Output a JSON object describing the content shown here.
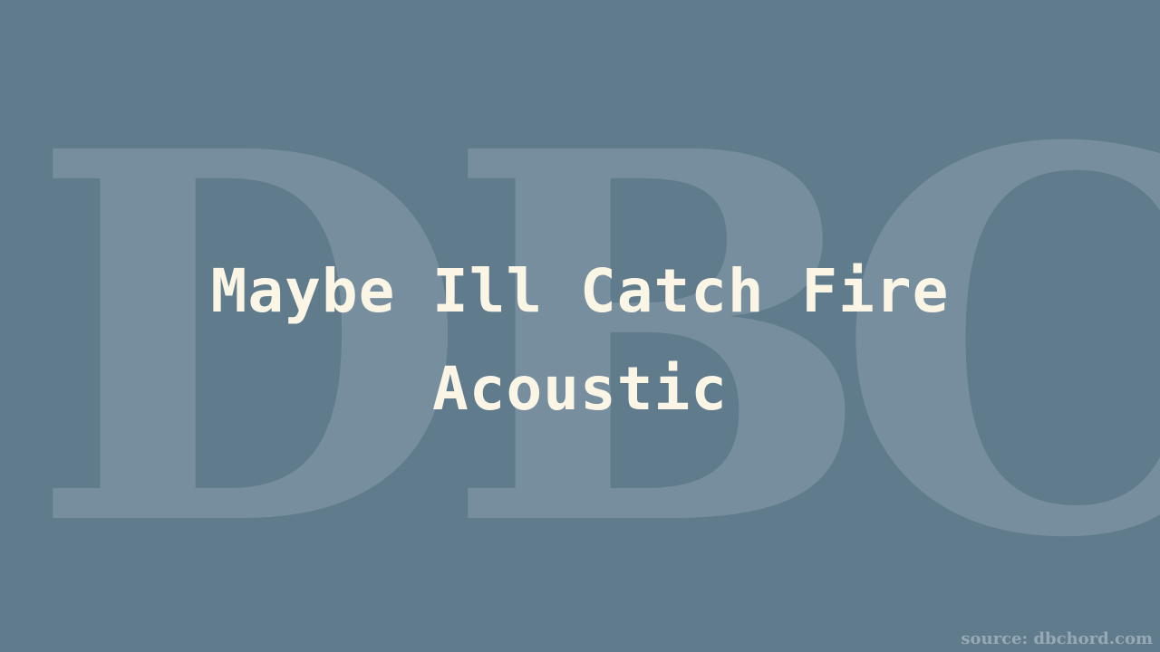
{
  "background_color": "#5f7b8c",
  "text_color": "#fbf5e6",
  "watermark": {
    "letters": [
      "D",
      "B",
      "C"
    ]
  },
  "title": {
    "line1": "Maybe Ill Catch Fire",
    "line2": "Acoustic"
  },
  "source": "source: dbchord.com"
}
